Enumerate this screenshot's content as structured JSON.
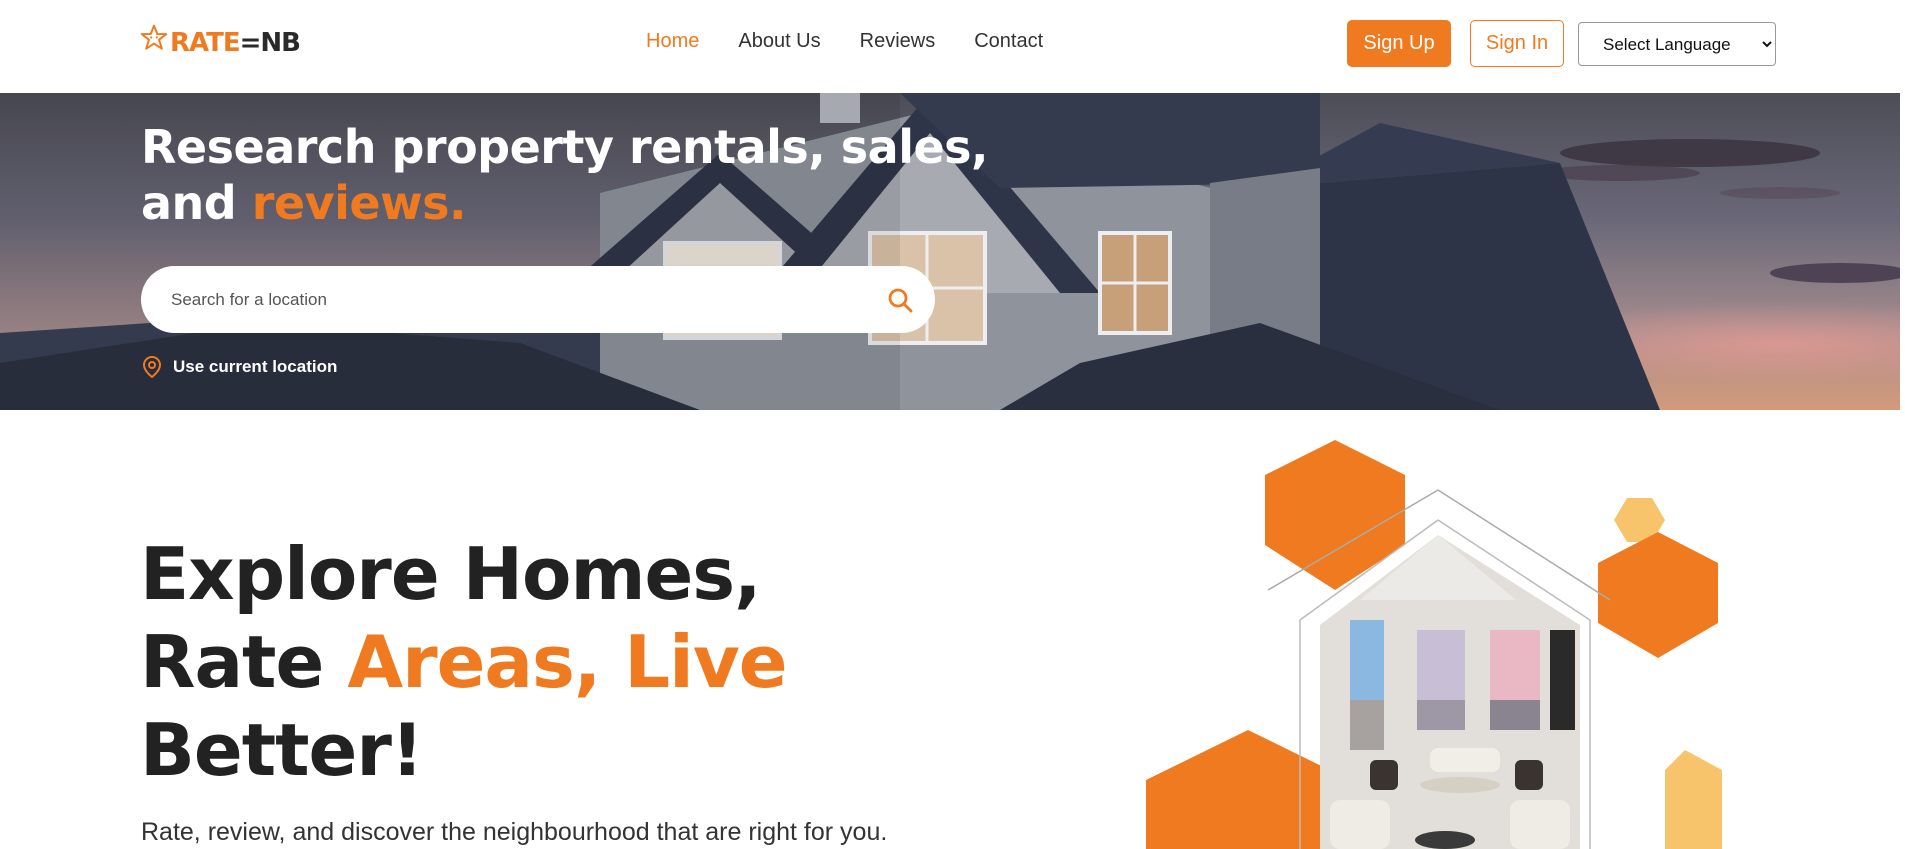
{
  "header": {
    "logo": {
      "text_main": "RATE",
      "text_mid": "=",
      "text_end": "NB"
    },
    "nav": [
      {
        "label": "Home",
        "active": true
      },
      {
        "label": "About Us",
        "active": false
      },
      {
        "label": "Reviews",
        "active": false
      },
      {
        "label": "Contact",
        "active": false
      }
    ],
    "signup_label": "Sign Up",
    "signin_label": "Sign In",
    "language": {
      "selected": "Select Language"
    }
  },
  "hero": {
    "title_line1": "Research property rentals, sales,",
    "title_line2_prefix": "and ",
    "title_line2_accent": "reviews.",
    "search": {
      "placeholder": "Search for a location"
    },
    "use_location_label": "Use current location"
  },
  "main": {
    "title_line1": "Explore Homes,",
    "title_line2_prefix": "Rate ",
    "title_line2_accent": "Areas, Live",
    "title_line3": "Better!",
    "subtitle": "Rate, review, and discover the neighbourhood that are right for you."
  },
  "colors": {
    "accent": "#f07a1f",
    "accent_light": "#f7c46b",
    "text_dark": "#222222"
  },
  "icons": [
    "star-logo-icon",
    "search-icon",
    "location-pin-icon",
    "chevron-down-icon"
  ]
}
